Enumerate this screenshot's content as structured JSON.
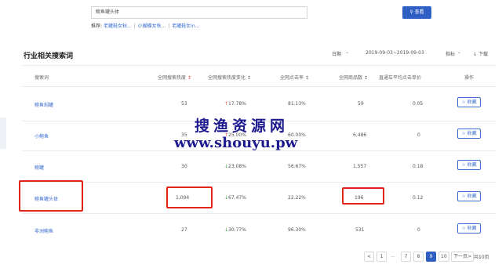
{
  "search": {
    "value": "鲍鱼罐头体",
    "button_label": "查看"
  },
  "recommend": {
    "label": "推荐:",
    "links": [
      "老罐鞋女秋...",
      "小蝴蝶女秋...",
      "老罐鞋女in..."
    ],
    "separator": "|"
  },
  "section": {
    "title": "行业相关搜索词",
    "date_label": "日期",
    "date_range": "2019-09-03~2019-09-03",
    "metric_label": "指标",
    "download_label": "下载"
  },
  "table": {
    "headers": [
      "搜索词",
      "全网搜索热度",
      "全网搜索热度变化",
      "全网点击率",
      "全网商品数",
      "直通车平均点击单价",
      "操作"
    ],
    "rows": [
      {
        "keyword": "鲍鱼焖罐",
        "heat": "53",
        "change": "17.78%",
        "direction": "up",
        "ctr": "81.13%",
        "products": "59",
        "cpc": "0.05",
        "action": "收藏"
      },
      {
        "keyword": "小鲍鱼",
        "heat": "35",
        "change": "25.00%",
        "direction": "up",
        "ctr": "60.00%",
        "products": "6,486",
        "cpc": "0",
        "action": "收藏"
      },
      {
        "keyword": "鲍罐",
        "heat": "30",
        "change": "23.08%",
        "direction": "down",
        "ctr": "56.67%",
        "products": "1,557",
        "cpc": "0.18",
        "action": "收藏"
      },
      {
        "keyword": "鲍鱼罐头体",
        "heat": "1,094",
        "change": "67.47%",
        "direction": "down",
        "ctr": "22.22%",
        "products": "196",
        "cpc": "0.12",
        "action": "收藏"
      },
      {
        "keyword": "非洲鲍鱼",
        "heat": "27",
        "change": "30.77%",
        "direction": "down",
        "ctr": "96.30%",
        "products": "531",
        "cpc": "0",
        "action": "收藏"
      }
    ]
  },
  "pagination": {
    "prev": "<",
    "pages": [
      "1",
      "...",
      "7",
      "8",
      "9",
      "10"
    ],
    "current": "9",
    "next_label": "下一页",
    "next_arrow": ">",
    "total_label": "共10页"
  },
  "watermark": {
    "line1": "搜渔资源网",
    "line2": "www.shouyu.pw"
  },
  "colors": {
    "accent": "#2f5ec4",
    "link": "#3b6ed1",
    "up": "#e84c3d",
    "down": "#3a9a45",
    "highlight": "#e2231a",
    "watermark": "#1d1a8f"
  }
}
